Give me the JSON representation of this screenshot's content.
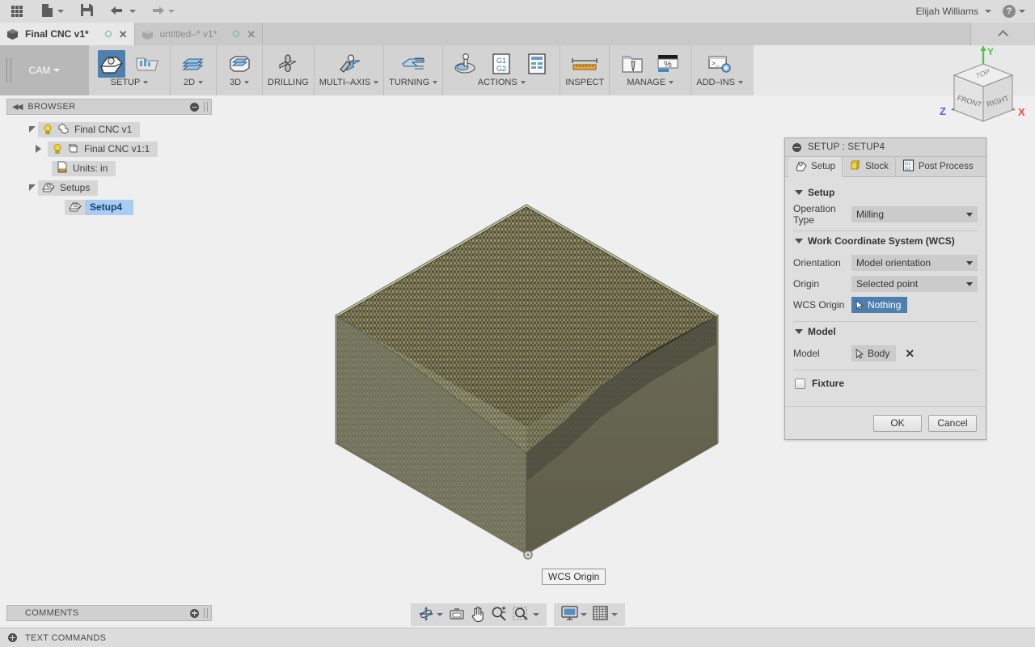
{
  "appbar": {
    "buttons": [
      {
        "name": "app-grid-button",
        "icon": "grid-icon"
      },
      {
        "name": "new-file-button",
        "icon": "file-icon",
        "caret": true
      },
      {
        "name": "save-button",
        "icon": "save-icon"
      },
      {
        "name": "undo-button",
        "icon": "undo-arrow-icon",
        "caret": true
      },
      {
        "name": "redo-button",
        "icon": "redo-arrow-icon",
        "caret": true
      }
    ],
    "user_name": "Elijah Williams",
    "help_label": "?"
  },
  "tabs": [
    {
      "label": "Final CNC v1*",
      "active": true
    },
    {
      "label": "untitled–* v1*",
      "active": false
    }
  ],
  "ribbon": {
    "workspace": "CAM",
    "groups": [
      {
        "label": "SETUP",
        "caret": true,
        "items": [
          {
            "label": "",
            "icon": "setup-icon",
            "selected": true
          },
          {
            "label": "",
            "icon": "folder-chart-icon",
            "selected": false
          }
        ]
      },
      {
        "label": "2D",
        "caret": true,
        "items": [
          {
            "icon": "2d-milling-icon"
          }
        ]
      },
      {
        "label": "3D",
        "caret": true,
        "items": [
          {
            "icon": "3d-milling-icon"
          }
        ]
      },
      {
        "label": "DRILLING",
        "caret": false,
        "items": [
          {
            "icon": "drilling-icon"
          }
        ]
      },
      {
        "label": "MULTI–AXIS",
        "caret": true,
        "items": [
          {
            "icon": "multiaxis-icon"
          }
        ]
      },
      {
        "label": "TURNING",
        "caret": true,
        "items": [
          {
            "icon": "turning-icon"
          }
        ]
      },
      {
        "label": "ACTIONS",
        "caret": true,
        "items": [
          {
            "icon": "simulate-icon"
          },
          {
            "icon": "g1g2-post-icon"
          },
          {
            "icon": "setup-sheet-icon"
          }
        ]
      },
      {
        "label": "INSPECT",
        "caret": false,
        "items": [
          {
            "icon": "ruler-icon"
          }
        ]
      },
      {
        "label": "MANAGE",
        "caret": true,
        "items": [
          {
            "icon": "tool-library-icon"
          },
          {
            "icon": "machine-percent-icon"
          }
        ]
      },
      {
        "label": "ADD–INS",
        "caret": true,
        "items": [
          {
            "icon": "addins-console-icon"
          }
        ]
      }
    ]
  },
  "browser": {
    "title": "BROWSER",
    "tree": [
      {
        "label": "Final CNC v1",
        "indent": 0,
        "toggle": "open",
        "bulb": true,
        "icon": "component-icon",
        "selected": false
      },
      {
        "label": "Final CNC v1:1",
        "indent": 1,
        "toggle": "closed",
        "bulb": true,
        "icon": "body-cube-icon",
        "selected": false
      },
      {
        "label": "Units: in",
        "indent": 1,
        "toggle": "none",
        "bulb": false,
        "icon": "units-doc-icon",
        "selected": false
      },
      {
        "label": "Setups",
        "indent": 0,
        "toggle": "open",
        "bulb": false,
        "icon": "setup-folder-icon",
        "selected": false
      },
      {
        "label": "Setup4",
        "indent": 2,
        "toggle": "none",
        "bulb": false,
        "icon": "setup-folder-icon",
        "selected": true
      }
    ]
  },
  "canvas": {
    "wcs_tooltip": "WCS Origin",
    "colors": {
      "background": "#efefef",
      "stock_top": "#c9c9a9",
      "stock_left": "#b7b9a2",
      "stock_right": "#8e8e77",
      "model_top": "#9b9671",
      "model_dark": "#4e4d3c",
      "edge": "#5d5d4e"
    }
  },
  "viewcube": {
    "face_top": "TOP",
    "face_front": "FRONT",
    "face_right": "RIGHT",
    "axis_x": "X",
    "axis_y": "Y",
    "axis_z": "Z",
    "axis_x_color": "#e4504a",
    "axis_y_color": "#52c24a",
    "axis_z_color": "#4a66e0"
  },
  "setup_dialog": {
    "title": "SETUP : SETUP4",
    "tabs": [
      {
        "label": "Setup",
        "icon": "setup-tab-icon",
        "selected": true
      },
      {
        "label": "Stock",
        "icon": "stock-cube-icon",
        "selected": false
      },
      {
        "label": "Post Process",
        "icon": "g1g2-icon",
        "selected": false
      }
    ],
    "sections": [
      {
        "heading": "Setup",
        "rows": [
          {
            "label": "Operation Type",
            "type": "combo",
            "value": "Milling"
          }
        ]
      },
      {
        "heading": "Work Coordinate System (WCS)",
        "rows": [
          {
            "label": "Orientation",
            "type": "combo",
            "value": "Model orientation"
          },
          {
            "label": "Origin",
            "type": "combo",
            "value": "Selected point"
          },
          {
            "label": "WCS Origin",
            "type": "select-active",
            "value": "Nothing"
          }
        ]
      },
      {
        "heading": "Model",
        "rows": [
          {
            "label": "Model",
            "type": "select-gray",
            "value": "Body",
            "clear": "✕"
          }
        ]
      }
    ],
    "fixture": {
      "label": "Fixture",
      "checked": false
    },
    "footer": {
      "ok": "OK",
      "cancel": "Cancel"
    },
    "accent_color": "#4e7fad"
  },
  "navbar": {
    "groups": [
      {
        "items": [
          {
            "name": "orbit-pan-button",
            "icon": "orbit-icon",
            "caret": true
          },
          {
            "name": "fit-view-button",
            "icon": "fit-icon",
            "caret": false
          },
          {
            "name": "pan-button",
            "icon": "hand-icon",
            "caret": false
          },
          {
            "name": "zoom-button",
            "icon": "zoom-plusminus-icon",
            "caret": false
          },
          {
            "name": "zoom-window-button",
            "icon": "zoom-window-icon",
            "caret": true
          }
        ]
      },
      {
        "items": [
          {
            "name": "display-settings-button",
            "icon": "monitor-icon",
            "caret": true
          },
          {
            "name": "grid-snaps-button",
            "icon": "grid-snap-icon",
            "caret": true
          }
        ]
      }
    ]
  },
  "comments": {
    "label": "COMMENTS"
  },
  "text_commands": {
    "label": "TEXT COMMANDS"
  }
}
